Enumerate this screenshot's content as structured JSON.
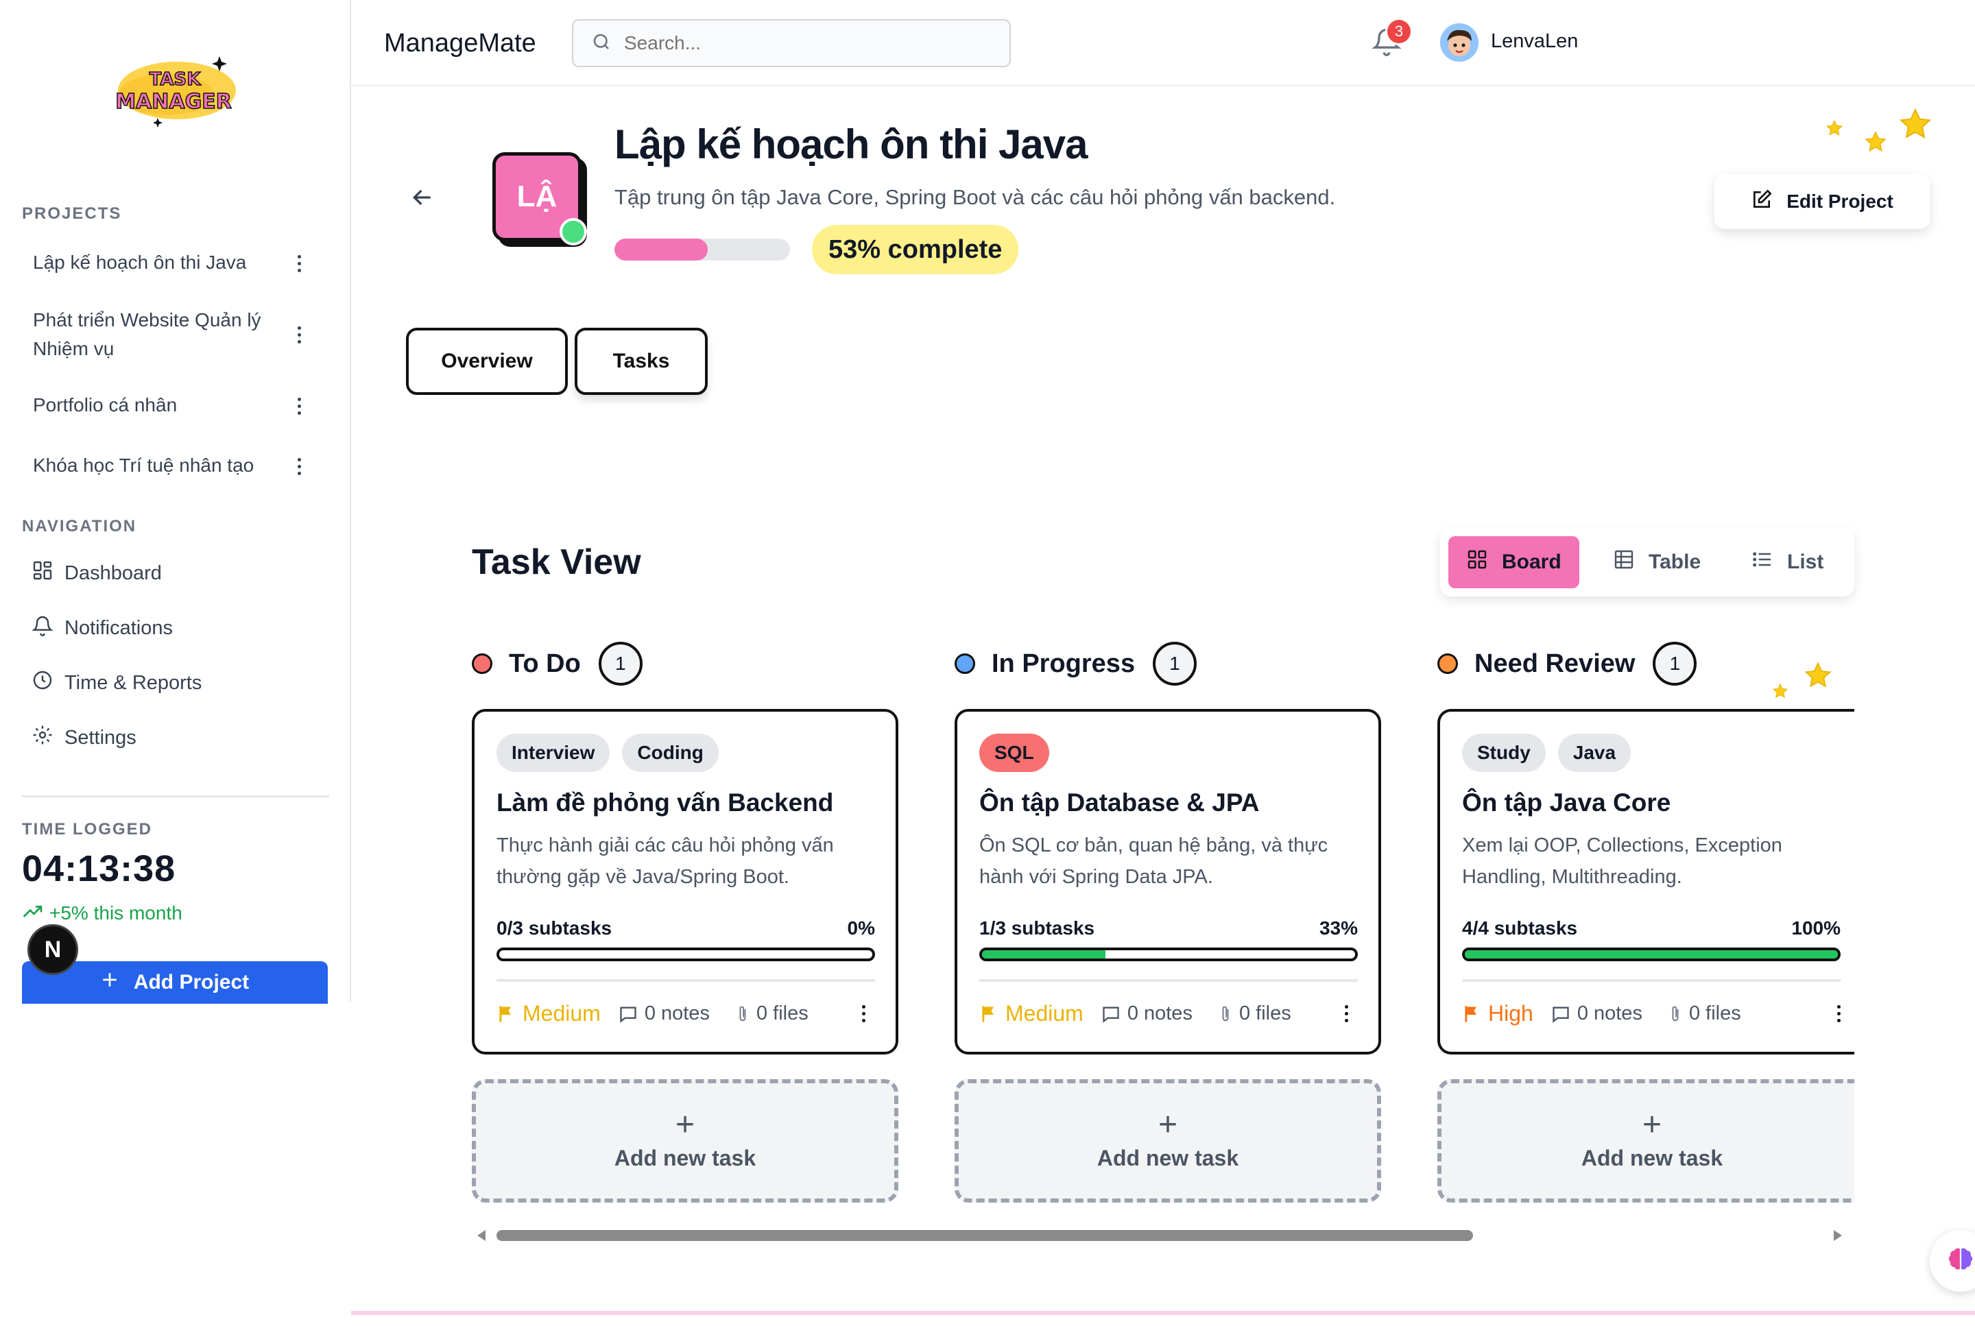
{
  "sidebar": {
    "projects_label": "PROJECTS",
    "projects": [
      {
        "label": "Lập kế hoạch ôn thi Java"
      },
      {
        "label": "Phát triển Website Quản lý Nhiệm vụ"
      },
      {
        "label": "Portfolio cá nhân"
      },
      {
        "label": "Khóa học Trí tuệ nhân tạo"
      }
    ],
    "navigation_label": "NAVIGATION",
    "nav": [
      {
        "label": "Dashboard",
        "icon": "dashboard-icon"
      },
      {
        "label": "Notifications",
        "icon": "bell-icon"
      },
      {
        "label": "Time & Reports",
        "icon": "clock-icon"
      },
      {
        "label": "Settings",
        "icon": "gear-icon"
      }
    ],
    "time_logged_label": "TIME LOGGED",
    "time_logged_value": "04:13:38",
    "time_change": "+5% this month",
    "add_project_label": "Add Project",
    "next_badge": "N"
  },
  "header": {
    "brand": "ManageMate",
    "search_placeholder": "Search...",
    "notification_count": "3",
    "username": "LenvaLen"
  },
  "project": {
    "avatar_initials": "LẬ",
    "title": "Lập kế hoạch ôn thi Java",
    "description": "Tập trung ôn tập Java Core, Spring Boot và các câu hỏi phỏng vấn backend.",
    "progress": 0.53,
    "progress_label": "53% complete",
    "edit_label": "Edit Project"
  },
  "tabs": [
    {
      "label": "Overview"
    },
    {
      "label": "Tasks"
    }
  ],
  "task_view": {
    "title": "Task View",
    "views": [
      {
        "label": "Board",
        "active": true
      },
      {
        "label": "Table",
        "active": false
      },
      {
        "label": "List",
        "active": false
      }
    ],
    "columns": [
      {
        "name": "To Do",
        "count": "1",
        "dot_color": "#f87171",
        "card": {
          "tags": [
            {
              "label": "Interview",
              "color": "#e5e7eb"
            },
            {
              "label": "Coding",
              "color": "#e5e7eb"
            }
          ],
          "title": "Làm đề phỏng vấn Backend",
          "description": "Thực hành giải các câu hỏi phỏng vấn thường gặp về Java/Spring Boot.",
          "subtasks": "0/3 subtasks",
          "percent": "0%",
          "progress": 0,
          "priority": "Medium",
          "priority_color": "#eab308",
          "notes": "0 notes",
          "files": "0 files"
        },
        "add_label": "Add new task"
      },
      {
        "name": "In Progress",
        "count": "1",
        "dot_color": "#60a5fa",
        "card": {
          "tags": [
            {
              "label": "SQL",
              "color": "#f87171"
            }
          ],
          "title": "Ôn tập Database & JPA",
          "description": "Ôn SQL cơ bản, quan hệ bảng, và thực hành với Spring Data JPA.",
          "subtasks": "1/3 subtasks",
          "percent": "33%",
          "progress": 0.33,
          "priority": "Medium",
          "priority_color": "#eab308",
          "notes": "0 notes",
          "files": "0 files"
        },
        "add_label": "Add new task"
      },
      {
        "name": "Need Review",
        "count": "1",
        "dot_color": "#fb923c",
        "card": {
          "tags": [
            {
              "label": "Study",
              "color": "#e5e7eb"
            },
            {
              "label": "Java",
              "color": "#e5e7eb"
            }
          ],
          "title": "Ôn tập Java Core",
          "description": "Xem lại OOP, Collections, Exception Handling, Multithreading.",
          "subtasks": "4/4 subtasks",
          "percent": "100%",
          "progress": 1,
          "priority": "High",
          "priority_color": "#f97316",
          "notes": "0 notes",
          "files": "0 files"
        },
        "add_label": "Add new task"
      }
    ]
  },
  "colors": {
    "accent_pink": "#f472b6",
    "primary_blue": "#2563eb",
    "highlight_yellow": "#fef08a",
    "success_green": "#22c55e"
  }
}
